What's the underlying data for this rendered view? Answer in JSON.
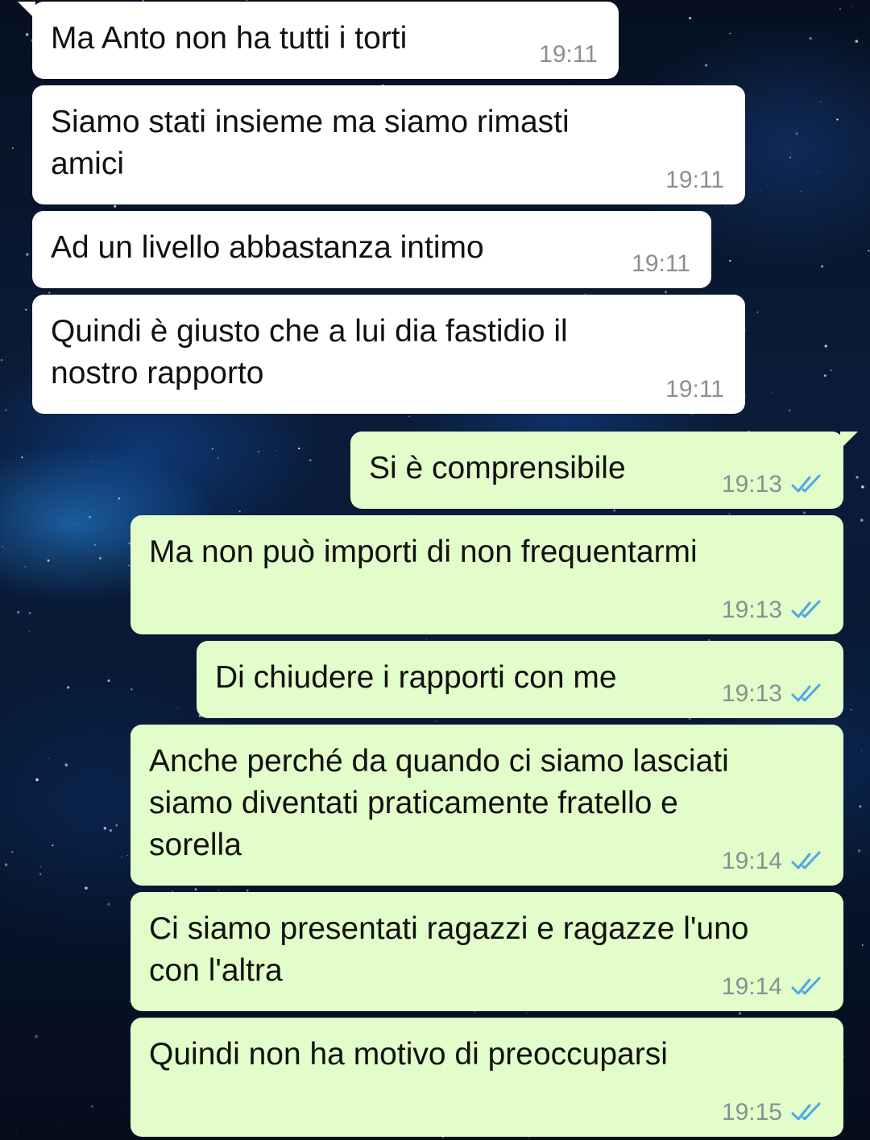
{
  "chat": {
    "messages": [
      {
        "text": "Ma Anto non ha tutti i torti",
        "time": "19:11",
        "direction": "incoming"
      },
      {
        "text": "Siamo stati insieme ma siamo rimasti\namici",
        "time": "19:11",
        "direction": "incoming"
      },
      {
        "text": "Ad un livello abbastanza intimo",
        "time": "19:11",
        "direction": "incoming"
      },
      {
        "text": "Quindi è giusto che a lui dia fastidio il\nnostro rapporto",
        "time": "19:11",
        "direction": "incoming"
      },
      {
        "text": "Si è comprensibile",
        "time": "19:13",
        "direction": "outgoing",
        "status": "read"
      },
      {
        "text": "Ma non può importi di non frequentarmi",
        "time": "19:13",
        "direction": "outgoing",
        "status": "read"
      },
      {
        "text": "Di chiudere i rapporti con me",
        "time": "19:13",
        "direction": "outgoing",
        "status": "read"
      },
      {
        "text": "Anche perché da quando ci siamo lasciati\nsiamo diventati praticamente fratello e\nsorella",
        "time": "19:14",
        "direction": "outgoing",
        "status": "read"
      },
      {
        "text": "Ci siamo presentati ragazzi e ragazze l'uno\ncon l'altra",
        "time": "19:14",
        "direction": "outgoing",
        "status": "read"
      },
      {
        "text": "Quindi non ha motivo di preoccuparsi",
        "time": "19:15",
        "direction": "outgoing",
        "status": "read"
      }
    ]
  },
  "colors": {
    "incoming_bubble": "#ffffff",
    "outgoing_bubble": "#e2fdc9",
    "timestamp": "#8a8f92",
    "read_ticks": "#4fa6e8",
    "background": "#0a1c3a"
  },
  "icons": {
    "read_status": "double-check-icon"
  }
}
